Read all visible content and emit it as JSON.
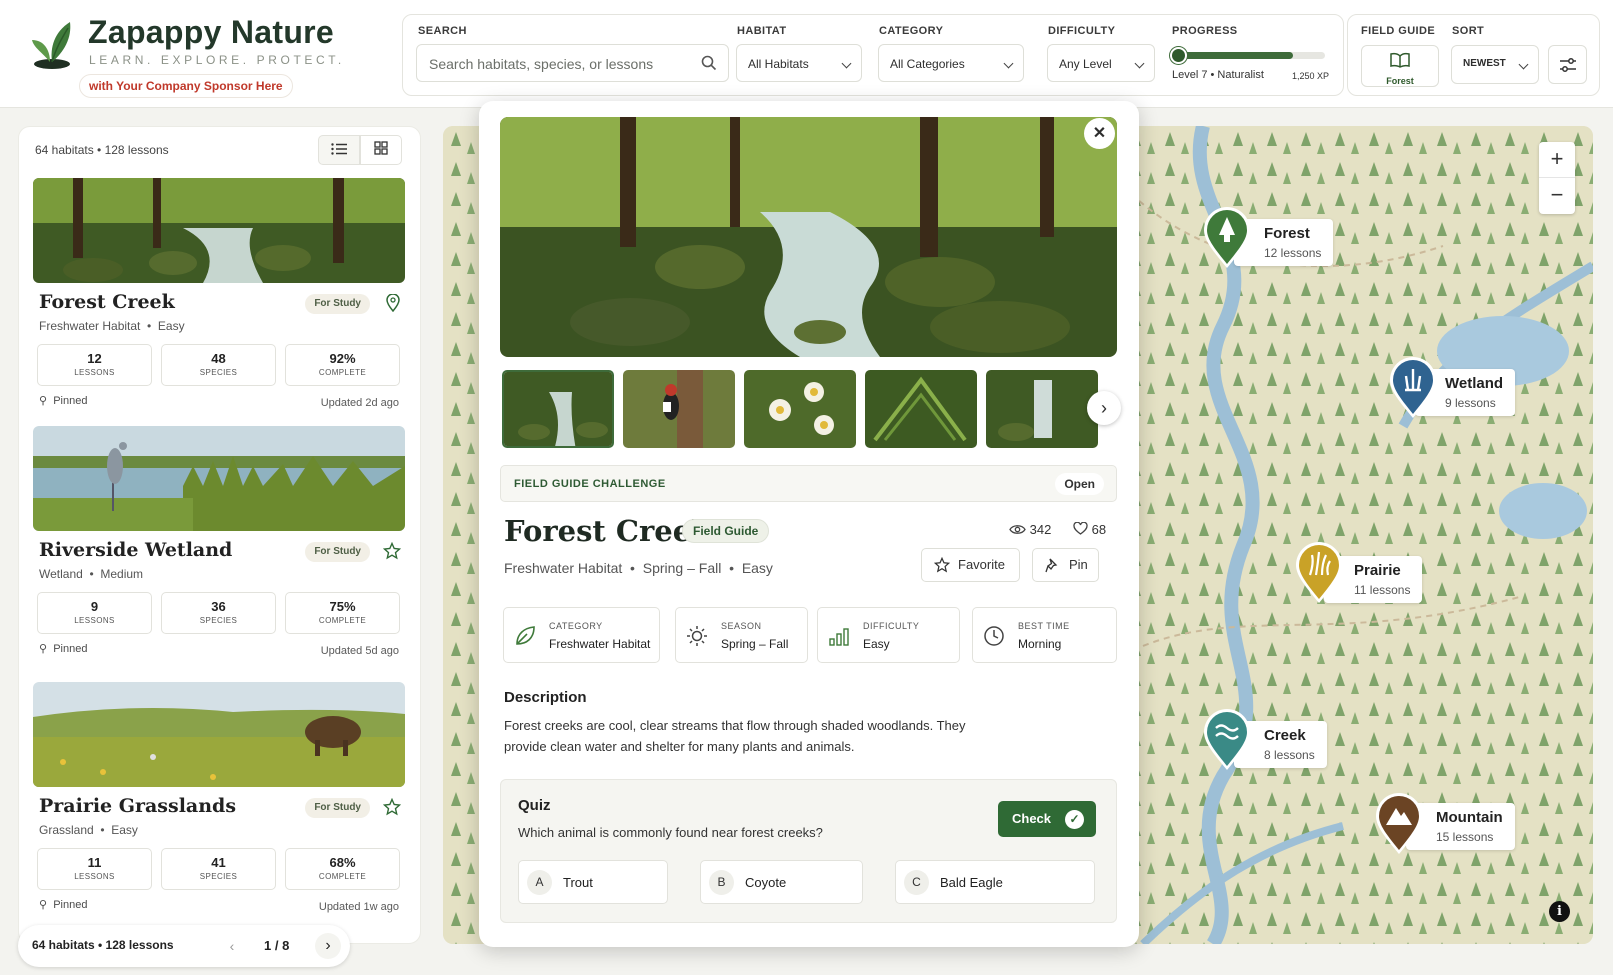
{
  "brand": {
    "name": "Zapappy Nature",
    "tagline": "LEARN. EXPLORE. PROTECT.",
    "sponsor": "with Your Company Sponsor Here"
  },
  "filters": {
    "search_label": "SEARCH",
    "search_placeholder": "Search habitats, species, or lessons",
    "habitat_label": "HABITAT",
    "habitat_value": "All Habitats",
    "category_label": "CATEGORY",
    "category_value": "All Categories",
    "difficulty_label": "DIFFICULTY",
    "difficulty_value": "Any Level",
    "progress_label": "PROGRESS",
    "progress_fraction": 0.79,
    "level_text": "Level 7 • Naturalist",
    "xp": "1,250 XP",
    "field_guide_label": "FIELD GUIDE",
    "field_guide_button": "Forest",
    "sort_label": "SORT",
    "sort_value": "NEWEST"
  },
  "sidebar": {
    "summary": "64 habitats • 128 lessons",
    "cards": [
      {
        "title": "Forest Creek",
        "badge": "For Study",
        "habitat": "Freshwater Habitat",
        "difficulty": "Easy",
        "lessons": "12",
        "species": "48",
        "complete": "92%",
        "pinned": "Pinned",
        "updated": "Updated 2d ago"
      },
      {
        "title": "Riverside Wetland",
        "badge": "For Study",
        "habitat": "Wetland",
        "difficulty": "Medium",
        "lessons": "9",
        "species": "36",
        "complete": "75%",
        "pinned": "Pinned",
        "updated": "Updated 5d ago"
      },
      {
        "title": "Prairie Grasslands",
        "badge": "For Study",
        "habitat": "Grassland",
        "difficulty": "Easy",
        "lessons": "11",
        "species": "41",
        "complete": "68%",
        "pinned": "Pinned",
        "updated": "Updated 1w ago"
      }
    ],
    "stat_labels": {
      "lessons": "LESSONS",
      "species": "SPECIES",
      "complete": "COMPLETE"
    },
    "pager": {
      "summary": "64 habitats • 128 lessons",
      "page": "1 / 8"
    }
  },
  "modal": {
    "challenge": "FIELD GUIDE CHALLENGE",
    "status": "Open",
    "title": "Forest Creek",
    "tag": "Field Guide",
    "habitat": "Freshwater Habitat",
    "season": "Spring – Fall",
    "difficulty": "Easy",
    "views": "342",
    "likes": "68",
    "favorite": "Favorite",
    "pin": "Pin",
    "info": [
      {
        "label": "CATEGORY",
        "value": "Freshwater Habitat"
      },
      {
        "label": "SEASON",
        "value": "Spring – Fall"
      },
      {
        "label": "DIFFICULTY",
        "value": "Easy"
      },
      {
        "label": "BEST TIME",
        "value": "Morning"
      }
    ],
    "description_heading": "Description",
    "description": "Forest creeks are cool, clear streams that flow through shaded woodlands. They provide clean water and shelter for many plants and animals.",
    "quiz": {
      "heading": "Quiz",
      "question": "Which animal is commonly found near forest creeks?",
      "check": "Check",
      "options": [
        {
          "key": "A",
          "text": "Trout"
        },
        {
          "key": "B",
          "text": "Coyote"
        },
        {
          "key": "C",
          "text": "Bald Eagle"
        }
      ]
    }
  },
  "map": {
    "pins": [
      {
        "name": "Forest",
        "lessons": "12 lessons",
        "color": "#3f7a3a"
      },
      {
        "name": "Wetland",
        "lessons": "9 lessons",
        "color": "#2f6390"
      },
      {
        "name": "Prairie",
        "lessons": "11 lessons",
        "color": "#c9a227"
      },
      {
        "name": "Creek",
        "lessons": "8 lessons",
        "color": "#3a8a86"
      },
      {
        "name": "Mountain",
        "lessons": "15 lessons",
        "color": "#6b4424"
      }
    ]
  }
}
